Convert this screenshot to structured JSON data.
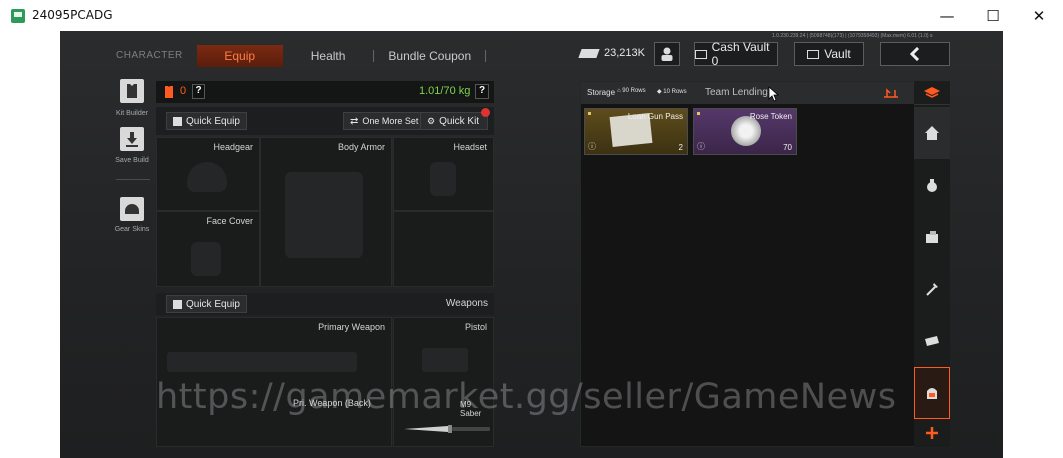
{
  "window": {
    "title": "24095PCADG",
    "controls": {
      "minimize": "—",
      "maximize": "☐",
      "close": "✕"
    }
  },
  "header": {
    "tabs": [
      {
        "label": "CHARACTER"
      },
      {
        "label": "Equip"
      },
      {
        "label": "Health"
      },
      {
        "label": "Bundle Coupon"
      }
    ],
    "currency": "23,213K",
    "cash_vault": "Cash Vault 0",
    "vault": "Vault",
    "debug_text": "1.0.230.239.24 | (5098748)(173) | (1079358493) (Max.mem) 6.01 (1.0) s"
  },
  "left_sidebar": {
    "items": [
      {
        "label": "Kit Builder",
        "icon": "vest-icon"
      },
      {
        "label": "Save Build",
        "icon": "download-icon"
      },
      {
        "label": "Gear Skins",
        "icon": "helmet-icon"
      }
    ]
  },
  "equip_panel": {
    "armor_value": "0",
    "help": "?",
    "weight": "1.01/70 kg",
    "quick_equip": "Quick Equip",
    "one_more_set": "One More Set",
    "quick_kit": "Quick Kit",
    "slots": {
      "headgear": "Headgear",
      "body_armor": "Body Armor",
      "headset": "Headset",
      "face_cover": "Face Cover"
    },
    "weapons": {
      "quick_equip": "Quick Equip",
      "section_label": "Weapons",
      "primary": "Primary Weapon",
      "pistol": "Pistol",
      "primary_back": "Pri. Weapon (Back)",
      "melee": "M9 Saber"
    }
  },
  "storage": {
    "tab_storage": "Storage",
    "rows_a": "90 Rows",
    "rows_b": "10 Rows",
    "tab_team": "Team Lending",
    "items": [
      {
        "name": "Loan Gun Pass",
        "count": "2"
      },
      {
        "name": "Rose Token",
        "count": "70"
      }
    ]
  },
  "watermark": "https://gamemarket.gg/seller/GameNews",
  "colors": {
    "accent": "#ff5a1f",
    "weight_green": "#7fd64a",
    "bg": "#232425"
  }
}
